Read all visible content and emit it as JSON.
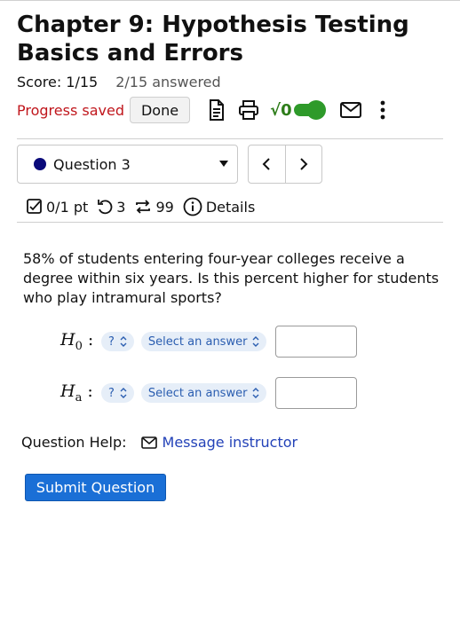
{
  "header": {
    "title": "Chapter 9: Hypothesis Testing Basics and Errors",
    "score": "Score: 1/15",
    "answered": "2/15 answered"
  },
  "toolbar": {
    "progress_status": "Progress saved",
    "done_label": "Done",
    "sqrt_label": "√0",
    "icons": [
      "document-icon",
      "print-icon",
      "math-toggle",
      "mail-icon",
      "more-vert-icon"
    ],
    "accent_color": "#2e9a2a"
  },
  "question_nav": {
    "selected": "Question 3",
    "prev": "‹",
    "next": "›",
    "dot_color": "#0a0a7a"
  },
  "meta": {
    "points": "0/1 pt",
    "retries": "3",
    "attempts": "99",
    "details": "Details"
  },
  "question": {
    "prompt": "58% of students entering four-year colleges receive a degree within six years. Is this percent higher for students who play intramural sports?",
    "hypotheses": [
      {
        "symbol": "H",
        "sub": "0",
        "colon": ":",
        "param_select": "?",
        "relation_select": "Select an answer",
        "value": ""
      },
      {
        "symbol": "H",
        "sub": "a",
        "colon": ":",
        "param_select": "?",
        "relation_select": "Select an answer",
        "value": ""
      }
    ]
  },
  "help": {
    "label": "Question Help:",
    "message_link": "Message instructor"
  },
  "submit_label": "Submit Question"
}
